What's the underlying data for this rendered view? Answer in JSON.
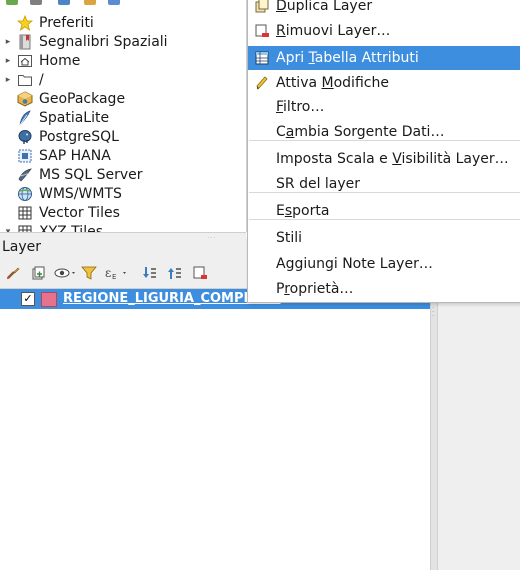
{
  "browser": {
    "items": [
      {
        "label": "Preferiti",
        "icon": "star-icon",
        "expander": ""
      },
      {
        "label": "Segnalibri Spaziali",
        "icon": "bookmark-book-icon",
        "expander": "▸"
      },
      {
        "label": "Home",
        "icon": "home-folder-icon",
        "expander": "▸"
      },
      {
        "label": "/",
        "icon": "folder-icon",
        "expander": "▸"
      },
      {
        "label": "GeoPackage",
        "icon": "geopackage-icon",
        "expander": ""
      },
      {
        "label": "SpatiaLite",
        "icon": "spatialite-feather-icon",
        "expander": ""
      },
      {
        "label": "PostgreSQL",
        "icon": "postgresql-elephant-icon",
        "expander": ""
      },
      {
        "label": "SAP HANA",
        "icon": "sap-hana-icon",
        "expander": ""
      },
      {
        "label": "MS SQL Server",
        "icon": "mssql-icon",
        "expander": ""
      },
      {
        "label": "WMS/WMTS",
        "icon": "wms-globe-icon",
        "expander": ""
      },
      {
        "label": "Vector Tiles",
        "icon": "vector-tiles-grid-icon",
        "expander": ""
      },
      {
        "label": "XYZ Tiles",
        "icon": "xyz-tiles-icon",
        "expander": "▾"
      }
    ]
  },
  "layers_panel": {
    "title": "Layer",
    "layer": {
      "name": "REGIONE_LIGURIA_COMPLETO",
      "checked": "✓",
      "swatch_color": "#e5738c"
    }
  },
  "context_menu": {
    "items": [
      {
        "pre": "",
        "u": "D",
        "post": "uplica Layer",
        "icon": "duplicate-layer-icon"
      },
      {
        "pre": "",
        "u": "R",
        "post": "imuovi Layer…",
        "icon": "remove-layer-icon"
      },
      {
        "pre": "Apri ",
        "u": "T",
        "post": "abella Attributi",
        "icon": "attribute-table-icon",
        "highlighted": true
      },
      {
        "pre": "Attiva ",
        "u": "M",
        "post": "odifiche",
        "icon": "pencil-edit-icon"
      },
      {
        "pre": "",
        "u": "F",
        "post": "iltro…",
        "icon": ""
      },
      {
        "pre": "C",
        "u": "a",
        "post": "mbia Sorgente Dati…",
        "icon": ""
      },
      {
        "pre": "Imposta Scala e ",
        "u": "V",
        "post": "isibilità Layer…",
        "icon": ""
      },
      {
        "pre": "SR del layer",
        "u": "",
        "post": "",
        "icon": ""
      },
      {
        "pre": "E",
        "u": "s",
        "post": "porta",
        "icon": ""
      },
      {
        "pre": "Stili",
        "u": "",
        "post": "",
        "icon": ""
      },
      {
        "pre": "Aggiungi Note Layer…",
        "u": "",
        "post": "",
        "icon": ""
      },
      {
        "pre": "P",
        "u": "r",
        "post": "oprietà…",
        "icon": ""
      }
    ]
  },
  "colors": {
    "highlight": "#3d8ede",
    "panel_bg": "#efefef"
  }
}
